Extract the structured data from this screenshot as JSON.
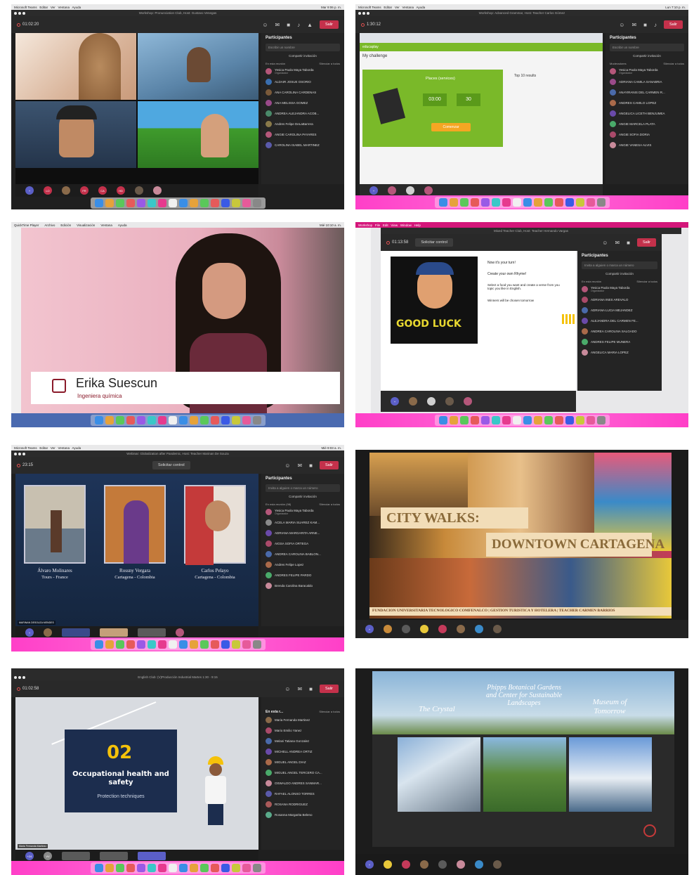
{
  "tiles": {
    "t1": {
      "title": "Workshop: Pronunciation Club, Host: Gustavo Venegas",
      "timer": "01:02:20",
      "leave": "Salir",
      "panel_title": "Participantes",
      "search": "Escribir un nombre",
      "invite": "Compartir invitación",
      "section": "En esta reunión",
      "mute_all": "Silenciar a todos",
      "people": [
        {
          "name": "Yesica Paola Maya Taborda",
          "role": "Organizador"
        },
        {
          "name": "ALDAIR JOSUE OSORIO"
        },
        {
          "name": "ANA CAROLINA CARDENAS"
        },
        {
          "name": "ANA MELISSA GOMEZ"
        },
        {
          "name": "ANDREA ALEJANDRA ACOB..."
        },
        {
          "name": "Andres Felipe DeLaBarrera"
        },
        {
          "name": "ANGIE CAROLINA PAYARES"
        },
        {
          "name": "CAROLINA ISABEL MARTINEZ"
        }
      ],
      "avatars": [
        "LO",
        "FR",
        "CA",
        "HD"
      ]
    },
    "t2": {
      "title": "Workshop: Advanced Grammar, Host: Teacher Carlos Gómez",
      "timer": "1:30:12",
      "leave": "Salir",
      "panel_title": "Participantes",
      "search": "Escribir un nombre",
      "invite": "Compartir invitación",
      "section": "Moderadores",
      "mute_all": "Silenciar a todos",
      "people": [
        {
          "name": "Yesica Paola Maya Taborda",
          "role": "Organizador"
        },
        {
          "name": "ADRIANA CAMILA SANABRIA"
        },
        {
          "name": "ANAYIRANIS DEL CARMEN R..."
        },
        {
          "name": "ANDRES CAMILO LOPEZ"
        },
        {
          "name": "ANGELICA LICETH BENJUMEA"
        },
        {
          "name": "ANGIE MARCELA PLATA"
        },
        {
          "name": "ANGIE SOFIA DORIA"
        },
        {
          "name": "ANGIE VANESA ALVIS"
        }
      ],
      "game": {
        "brand": "educaplay",
        "heading": "My challenge",
        "section": "Places (services)",
        "time": "03:00",
        "score": "30",
        "start": "Comenzar",
        "top": "Top 10 results"
      }
    },
    "t3": {
      "app": "QuickTime Player",
      "menu": [
        "Archivo",
        "Edición",
        "Visualización",
        "Ventana",
        "Ayuda"
      ],
      "clock": "Mié 10:10 a. m.",
      "name": "Erika Suescun",
      "role": "Ingeniera química"
    },
    "t4": {
      "title": "Mixed Teacher Club, Host: Teacher Hernando Vargas",
      "timer": "01:13:58",
      "control": "Solicitar control",
      "leave": "Salir",
      "panel_title": "Participantes",
      "search": "Invita a alguien o marca un número",
      "invite": "Compartir invitación",
      "section": "En esta reunión",
      "mute_all": "Silenciar a todos",
      "slide_text": [
        "Now it's your turn!",
        "Create your own Rhyme!",
        "Select a food you want and create a verse from you topic you like in English.",
        "Winners will be chosen tomorrow"
      ],
      "sticker": "GOOD LUCK",
      "people": [
        {
          "name": "Yesica Paola Maya Taborda",
          "role": "Organizador"
        },
        {
          "name": "ADRIANA INES AREVALO"
        },
        {
          "name": "ADRIANA LUCIA MEJANDEZ"
        },
        {
          "name": "ALEJANDRA DEL CARMEN FE..."
        },
        {
          "name": "ANDREA CAROLINA SALGADO"
        },
        {
          "name": "ANDRES FELIPE MUNERA"
        },
        {
          "name": "ANGELICA MARIA LOPEZ"
        }
      ]
    },
    "t5": {
      "title": "Webinar: Globalization after Pandemic, Host: Teacher Marinan De Souza",
      "timer": "23:15",
      "control": "Solicitar control",
      "leave": "Salir",
      "panel_title": "Participantes",
      "search": "Invita a alguien o marca un número",
      "invite": "Compartir invitación",
      "section": "En esta reunión (98)",
      "mute_all": "Silenciar a todos",
      "people": [
        {
          "name": "Yesica Paola Maya Taborda",
          "role": "Organizador"
        },
        {
          "name": "ACELA MARIA SUAREZ KAM..."
        },
        {
          "name": "ADRIANA MARGARITA ARNE..."
        },
        {
          "name": "AIGSA SOFIA ORTEGA"
        },
        {
          "name": "ANDREA CAROLINA BABLON..."
        },
        {
          "name": "Andres Felipe Lopez"
        },
        {
          "name": "ANDRES FELIPE PARDO"
        },
        {
          "name": "Brenda Carolina Baracaldo"
        }
      ],
      "captions": [
        {
          "name": "Álvaro Molinares",
          "place": "Tours - France"
        },
        {
          "name": "Rossny Vergara",
          "place": "Cartagena - Colombia"
        },
        {
          "name": "Carlos Pelayo",
          "place": "Cartagena - Colombia"
        }
      ],
      "presenter": "MARINAN DESOUZA MENDES"
    },
    "t6": {
      "title_1": "CITY WALKS:",
      "title_2": "DOWNTOWN CARTAGENA",
      "footer": "FUNDACION UNIVERSITARIA TECNOLOGICO COMFENALCO | GESTION TURISTICA Y HOTELERA | TEACHER CARMEN BARRIOS"
    },
    "t7": {
      "title": "English Club: (V)Producción Industrial Martes 1:30 - 9:15",
      "timer": "01:02:58",
      "leave": "Salir",
      "panel_title": "En esta r...",
      "mute_all": "Silenciar a todos",
      "slide_num": "02",
      "slide_title": "Occupational health and safety",
      "slide_sub": "Protection techniques",
      "people": [
        {
          "name": "Maria Fernanda Martinez"
        },
        {
          "name": "Mario Emilio Yanez"
        },
        {
          "name": "Melani Tatiana Gonzalez"
        },
        {
          "name": "MICHELL ANDREA ORTIZ"
        },
        {
          "name": "MIGUEL ANGEL DIAZ"
        },
        {
          "name": "MIGUEL ANGEL TERCERO CA..."
        },
        {
          "name": "OSWALDO ANDRES SANMAR..."
        },
        {
          "name": "RAFAEL ALONSO TORRES"
        },
        {
          "name": "ROSANA RODRIGUEZ"
        },
        {
          "name": "Rosanna Margarita Beleno"
        }
      ],
      "avatars": [
        "+24",
        "VV"
      ]
    },
    "t8": {
      "label_1": "The Crystal",
      "label_2": "Phipps Botanical Gardens and Center for Sustainable Landscapes",
      "label_3": "Museum of Tomorrow"
    }
  },
  "colors": {
    "teams_dark": "#292929",
    "leave_red": "#c4314b",
    "dock_pink": "#ff3fc8",
    "educaplay_green": "#7ab929"
  }
}
